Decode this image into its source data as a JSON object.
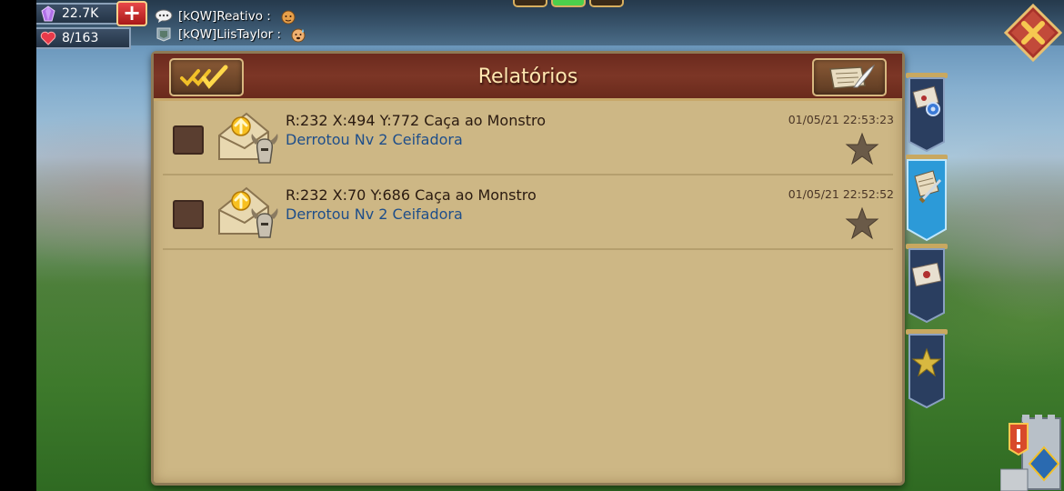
{
  "resources": {
    "gems": "22.7K",
    "life": "8/163",
    "plus_label": "+"
  },
  "chat": [
    {
      "text": "[kQW]Reativo :",
      "icon": "chat-bubble-icon",
      "emoji": "face-emoji"
    },
    {
      "text": "[kQW]LiisTaylor :",
      "icon": "guild-banner-icon",
      "emoji": "sweating-emoji"
    }
  ],
  "panel": {
    "title": "Relatórios",
    "left_button_icon": "mark-all-read-icon",
    "right_button_icon": "scroll-quill-icon"
  },
  "reports": [
    {
      "title": "R:232 X:494 Y:772 Caça ao Monstro",
      "subtitle": "Derrotou Nv 2 Ceifadora",
      "timestamp": "01/05/21 22:53:23",
      "starred": false
    },
    {
      "title": "R:232 X:70 Y:686 Caça ao Monstro",
      "subtitle": "Derrotou Nv 2 Ceifadora",
      "timestamp": "01/05/21 22:52:52",
      "starred": false
    }
  ],
  "tabs": [
    {
      "name": "mail-settings",
      "icon": "letter-gear-icon",
      "active": false
    },
    {
      "name": "reports",
      "icon": "scroll-sword-icon",
      "active": true
    },
    {
      "name": "messages",
      "icon": "sealed-letter-icon",
      "active": false
    },
    {
      "name": "favorites",
      "icon": "star-icon",
      "active": false
    }
  ],
  "colors": {
    "panel_header": "#7c3626",
    "panel_body": "#cdb785",
    "title_text": "#ffe7b0",
    "subtitle_text": "#1e4e8a",
    "tab_active": "#2c9ad8",
    "tab_inactive": "#2a3e60"
  }
}
